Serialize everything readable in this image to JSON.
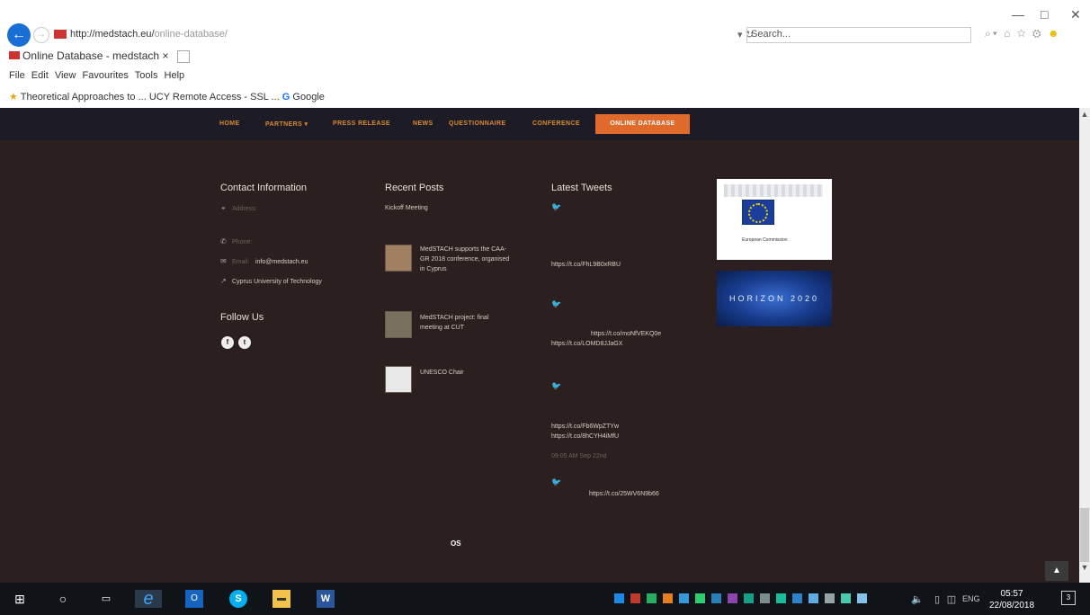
{
  "browser": {
    "url_host": "http://medstach.eu/",
    "url_path": "online-database/",
    "refresh_label": "▾ ↻",
    "search_placeholder": "Search...",
    "tab_title": "Online Database - medstach",
    "tab_close": "×",
    "menu": [
      "File",
      "Edit",
      "View",
      "Favourites",
      "Tools",
      "Help"
    ],
    "favourites": [
      "Theoretical Approaches to ...",
      "UCY Remote Access - SSL ...",
      "Google"
    ],
    "window_controls": [
      "—",
      "□",
      "✕"
    ]
  },
  "nav": {
    "items": [
      "HOME",
      "PARTNERS ▾",
      "PRESS RELEASE",
      "NEWS",
      "QUESTIONNAIRE",
      "CONFERENCE"
    ],
    "active": "ONLINE DATABASE"
  },
  "contact": {
    "heading": "Contact Information",
    "address_label": "Address:",
    "phone_label": "Phone:",
    "email_label": "Email:",
    "email_value": "info@medstach.eu",
    "university": "Cyprus University of Technology"
  },
  "follow": {
    "heading": "Follow Us",
    "icons": [
      "facebook-icon",
      "twitter-icon"
    ]
  },
  "recent_posts": {
    "heading": "Recent Posts",
    "first_title": "Kickoff Meeting",
    "posts": [
      {
        "title_line1": "MedSTACH supports the CAA-",
        "title_line2": "GR 2018 conference, organised",
        "title_line3": "in Cyprus"
      },
      {
        "title_line1": "MedSTACH project: final",
        "title_line2": "meeting at CUT"
      },
      {
        "title_line1": "UNESCO Chair"
      }
    ]
  },
  "tweets": {
    "heading": "Latest Tweets",
    "items": [
      {
        "link1": "https://t.co/FhL9B0xRBU"
      },
      {
        "link0": "https://t.co/moNfVEKQ0e",
        "link1": "https://t.co/LOMD8JJaGX"
      },
      {
        "link1": "https://t.co/Fb6WpZTYw",
        "link2": "https://t.co/8hCYH4iMfU",
        "date": "09:05 AM Sep 22nd"
      },
      {
        "link1": "https://t.co/25WV6N9b66"
      }
    ]
  },
  "partners": {
    "ec_caption": "European Commission",
    "h2020": "HORIZON 2020"
  },
  "footer": {
    "copyright_suffix": "OS"
  },
  "taskbar": {
    "time": "05:57",
    "date": "22/08/2018",
    "lang": "ENG",
    "notifications": "3"
  }
}
